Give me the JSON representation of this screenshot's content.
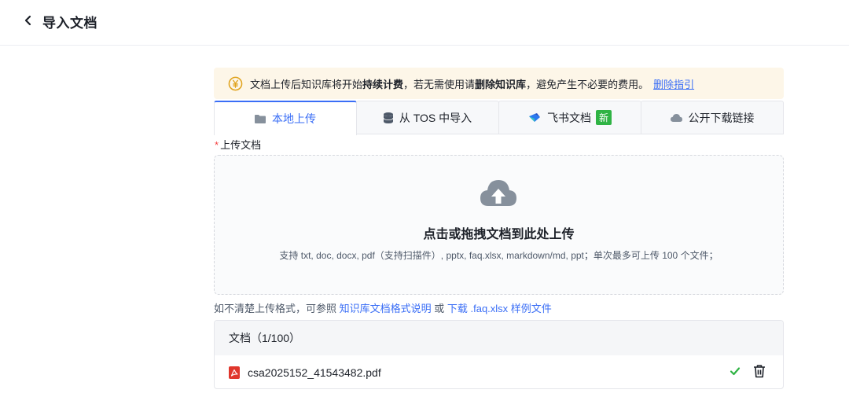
{
  "header": {
    "title": "导入文档"
  },
  "notice": {
    "text_1": "文档上传后知识库将开始",
    "bold_1": "持续计费",
    "text_2": "，若无需使用请",
    "bold_2": "删除知识库",
    "text_3": "，避免产生不必要的费用。",
    "link": "删除指引"
  },
  "tabs": [
    {
      "label": "本地上传",
      "icon": "folder-icon"
    },
    {
      "label": "从 TOS 中导入",
      "icon": "database-icon"
    },
    {
      "label": "飞书文档",
      "icon": "feishu-icon",
      "badge": "新"
    },
    {
      "label": "公开下载链接",
      "icon": "cloud-icon"
    }
  ],
  "upload": {
    "label": "上传文档",
    "required_mark": "*",
    "dropzone_title": "点击或拖拽文档到此处上传",
    "dropzone_subtitle": "支持 txt, doc, docx, pdf（支持扫描件）, pptx, faq.xlsx, markdown/md, ppt；单次最多可上传 100 个文件；"
  },
  "hint": {
    "prefix": "如不清楚上传格式，可参照 ",
    "link_1": "知识库文档格式说明",
    "middle": " 或 ",
    "link_2": "下载 .faq.xlsx 样例文件"
  },
  "doclist": {
    "header": "文档（1/100）",
    "files": [
      {
        "name": "csa2025152_41543482.pdf",
        "status": "done"
      }
    ]
  },
  "colors": {
    "accent": "#3a6ef6",
    "notice_bg": "#fdf6e8",
    "success": "#2fb344",
    "pdf_red": "#e0362c"
  }
}
